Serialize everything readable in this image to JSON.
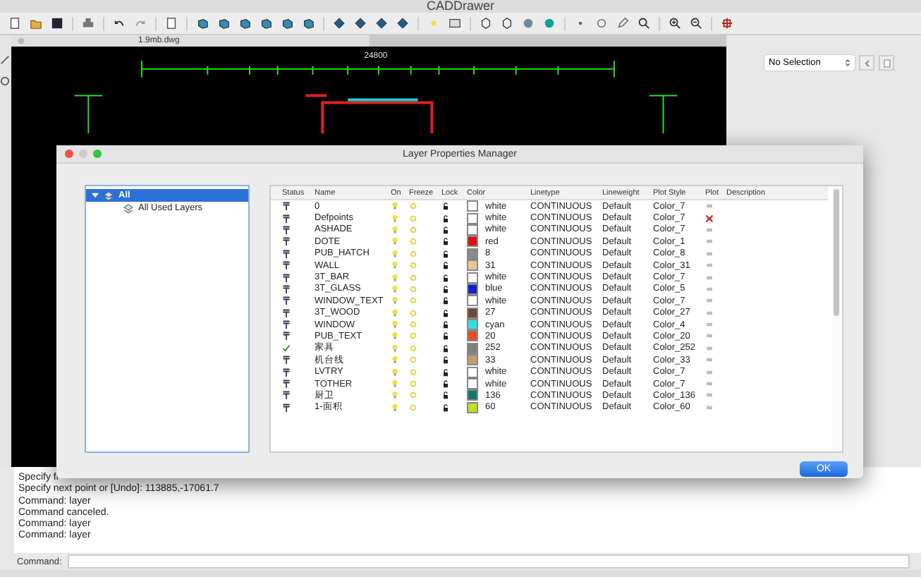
{
  "window": {
    "title": "CADDrawer"
  },
  "document_tab": {
    "label": "1.9mb.dwg"
  },
  "drawing": {
    "overall_dimension": "24800"
  },
  "properties_panel": {
    "selection": "No Selection"
  },
  "dialog": {
    "title": "Layer Properties Manager",
    "filter_tree": [
      {
        "label": "All",
        "selected": true,
        "expanded": true,
        "children": [
          {
            "label": "All Used Layers",
            "selected": false
          }
        ]
      }
    ],
    "columns": [
      "Status",
      "Name",
      "On",
      "Freeze",
      "Lock",
      "Color",
      "Linetype",
      "Lineweight",
      "Plot Style",
      "Plot",
      "Description"
    ],
    "layers": [
      {
        "current": false,
        "name": "0",
        "on": true,
        "frozen": false,
        "locked": false,
        "color": "#ffffff",
        "color_name": "white",
        "linetype": "CONTINUOUS",
        "lineweight": "Default",
        "plot_style": "Color_7",
        "plot": true
      },
      {
        "current": false,
        "name": "Defpoints",
        "on": true,
        "frozen": false,
        "locked": false,
        "color": "#ffffff",
        "color_name": "white",
        "linetype": "CONTINUOUS",
        "lineweight": "Default",
        "plot_style": "Color_7",
        "plot": false
      },
      {
        "current": false,
        "name": "ASHADE",
        "on": true,
        "frozen": false,
        "locked": false,
        "color": "#ffffff",
        "color_name": "white",
        "linetype": "CONTINUOUS",
        "lineweight": "Default",
        "plot_style": "Color_7",
        "plot": true
      },
      {
        "current": false,
        "name": "DOTE",
        "on": true,
        "frozen": false,
        "locked": false,
        "color": "#e01010",
        "color_name": "red",
        "linetype": "CONTINUOUS",
        "lineweight": "Default",
        "plot_style": "Color_1",
        "plot": true
      },
      {
        "current": false,
        "name": "PUB_HATCH",
        "on": true,
        "frozen": false,
        "locked": false,
        "color": "#8a8a8a",
        "color_name": "8",
        "linetype": "CONTINUOUS",
        "lineweight": "Default",
        "plot_style": "Color_8",
        "plot": true
      },
      {
        "current": false,
        "name": "WALL",
        "on": true,
        "frozen": false,
        "locked": false,
        "color": "#e8c890",
        "color_name": "31",
        "linetype": "CONTINUOUS",
        "lineweight": "Default",
        "plot_style": "Color_31",
        "plot": true
      },
      {
        "current": false,
        "name": "3T_BAR",
        "on": true,
        "frozen": false,
        "locked": false,
        "color": "#ffffff",
        "color_name": "white",
        "linetype": "CONTINUOUS",
        "lineweight": "Default",
        "plot_style": "Color_7",
        "plot": true
      },
      {
        "current": false,
        "name": "3T_GLASS",
        "on": true,
        "frozen": false,
        "locked": false,
        "color": "#1020d0",
        "color_name": "blue",
        "linetype": "CONTINUOUS",
        "lineweight": "Default",
        "plot_style": "Color_5",
        "plot": true
      },
      {
        "current": false,
        "name": "WINDOW_TEXT",
        "on": true,
        "frozen": false,
        "locked": false,
        "color": "#ffffff",
        "color_name": "white",
        "linetype": "CONTINUOUS",
        "lineweight": "Default",
        "plot_style": "Color_7",
        "plot": true
      },
      {
        "current": false,
        "name": "3T_WOOD",
        "on": true,
        "frozen": false,
        "locked": false,
        "color": "#6a4a3a",
        "color_name": "27",
        "linetype": "CONTINUOUS",
        "lineweight": "Default",
        "plot_style": "Color_27",
        "plot": true
      },
      {
        "current": false,
        "name": "WINDOW",
        "on": true,
        "frozen": false,
        "locked": false,
        "color": "#30e0e0",
        "color_name": "cyan",
        "linetype": "CONTINUOUS",
        "lineweight": "Default",
        "plot_style": "Color_4",
        "plot": true
      },
      {
        "current": false,
        "name": "PUB_TEXT",
        "on": true,
        "frozen": false,
        "locked": false,
        "color": "#e05020",
        "color_name": "20",
        "linetype": "CONTINUOUS",
        "lineweight": "Default",
        "plot_style": "Color_20",
        "plot": true
      },
      {
        "current": true,
        "name": "家具",
        "on": true,
        "frozen": false,
        "locked": false,
        "color": "#808080",
        "color_name": "252",
        "linetype": "CONTINUOUS",
        "lineweight": "Default",
        "plot_style": "Color_252",
        "plot": true
      },
      {
        "current": false,
        "name": "机台线",
        "on": true,
        "frozen": false,
        "locked": false,
        "color": "#c0a070",
        "color_name": "33",
        "linetype": "CONTINUOUS",
        "lineweight": "Default",
        "plot_style": "Color_33",
        "plot": true
      },
      {
        "current": false,
        "name": "LVTRY",
        "on": true,
        "frozen": false,
        "locked": false,
        "color": "#ffffff",
        "color_name": "white",
        "linetype": "CONTINUOUS",
        "lineweight": "Default",
        "plot_style": "Color_7",
        "plot": true
      },
      {
        "current": false,
        "name": "TOTHER",
        "on": true,
        "frozen": false,
        "locked": false,
        "color": "#ffffff",
        "color_name": "white",
        "linetype": "CONTINUOUS",
        "lineweight": "Default",
        "plot_style": "Color_7",
        "plot": true
      },
      {
        "current": false,
        "name": "厨卫",
        "on": true,
        "frozen": false,
        "locked": false,
        "color": "#107a6a",
        "color_name": "136",
        "linetype": "CONTINUOUS",
        "lineweight": "Default",
        "plot_style": "Color_136",
        "plot": true
      },
      {
        "current": false,
        "name": "1-面积",
        "on": true,
        "frozen": false,
        "locked": false,
        "color": "#c0e020",
        "color_name": "60",
        "linetype": "CONTINUOUS",
        "lineweight": "Default",
        "plot_style": "Color_60",
        "plot": true
      }
    ],
    "ok_button": "OK"
  },
  "command_history": [
    "Specify fi",
    "Specify next point or [Undo]: 113885,-17061.7",
    "Command: layer",
    "Command canceled.",
    "Command: layer",
    "Command: layer"
  ],
  "command_line": {
    "label": "Command:"
  }
}
